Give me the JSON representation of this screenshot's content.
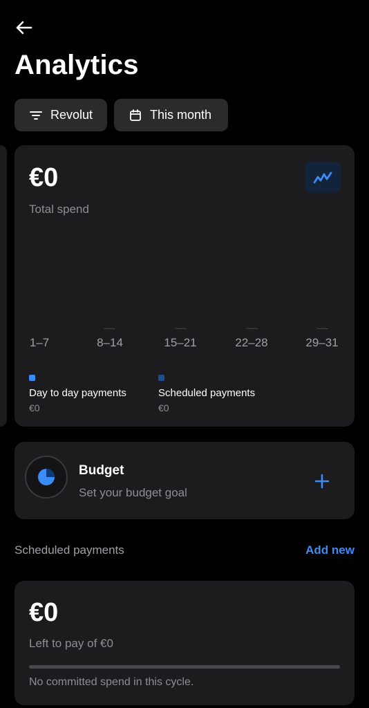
{
  "header": {
    "title": "Analytics"
  },
  "filters": {
    "account_label": "Revolut",
    "period_label": "This month"
  },
  "spend_card": {
    "amount": "€0",
    "subtitle": "Total spend",
    "weeks": [
      "1–7",
      "8–14",
      "15–21",
      "22–28",
      "29–31"
    ],
    "placeholder_dash": "~~~",
    "legend": [
      {
        "label": "Day to day payments",
        "value": "€0",
        "color": "#3b8cf7"
      },
      {
        "label": "Scheduled payments",
        "value": "€0",
        "color": "#1e4f91"
      }
    ]
  },
  "budget": {
    "title": "Budget",
    "subtitle": "Set your budget goal"
  },
  "scheduled": {
    "section_title": "Scheduled payments",
    "add_label": "Add new",
    "amount": "€0",
    "subtitle": "Left to pay of €0",
    "progress": 0,
    "empty_message": "No committed spend in this cycle."
  },
  "colors": {
    "accent": "#3b8cf7",
    "card": "#1c1c1f",
    "chip": "#2b2b2e",
    "background": "#000000"
  }
}
